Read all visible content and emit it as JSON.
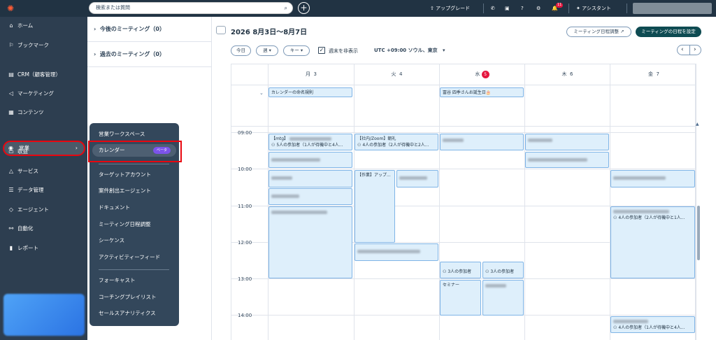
{
  "topbar": {
    "search_placeholder": "検索または質問",
    "upgrade_label": "アップグレード",
    "notification_count": "11",
    "assistant_label": "アシスタント"
  },
  "sidebar": {
    "items": [
      {
        "label": "ホーム",
        "icon": "home-icon"
      },
      {
        "label": "ブックマーク",
        "icon": "bookmark-icon"
      },
      {
        "label": "CRM（顧客管理）",
        "icon": "crm-icon"
      },
      {
        "label": "マーケティング",
        "icon": "marketing-icon"
      },
      {
        "label": "コンテンツ",
        "icon": "content-icon"
      },
      {
        "label": "営業",
        "icon": "sales-icon"
      },
      {
        "label": "収益",
        "icon": "revenue-icon"
      },
      {
        "label": "サービス",
        "icon": "service-icon"
      },
      {
        "label": "データ管理",
        "icon": "database-icon"
      },
      {
        "label": "エージェント",
        "icon": "agent-icon"
      },
      {
        "label": "自動化",
        "icon": "automation-icon"
      },
      {
        "label": "レポート",
        "icon": "report-icon"
      }
    ]
  },
  "flyout": {
    "items": [
      "営業ワークスペース",
      "カレンダー",
      "ターゲットアカウント",
      "案件創出エージェント",
      "ドキュメント",
      "ミーティング日程調整",
      "シーケンス",
      "アクティビティーフィード",
      "フォーキャスト",
      "コーチングプレイリスト",
      "セールスアナリティクス"
    ],
    "beta_label": "ベータ"
  },
  "meetings": {
    "upcoming": "今後のミーティング（0）",
    "past": "過去のミーティング（0）"
  },
  "calendar": {
    "title": "2026 8月3日〜8月7日",
    "scheduling_button": "ミーティング日程調整",
    "set_meeting_button": "ミーティングの日程を設定",
    "today_button": "今日",
    "view_select": "週",
    "key_select": "キー",
    "hide_weekend_label": "週末を非表示",
    "timezone": "UTC +09:00 ソウル、東京",
    "days": [
      {
        "name": "月",
        "num": "3"
      },
      {
        "name": "火",
        "num": "4"
      },
      {
        "name": "水",
        "num": "5"
      },
      {
        "name": "木",
        "num": "6"
      },
      {
        "name": "金",
        "num": "7"
      }
    ],
    "hours": [
      "09:00",
      "10:00",
      "11:00",
      "12:00",
      "13:00",
      "14:00"
    ],
    "allday": {
      "mon": "カレンダーの命名規則",
      "wed": "冨谷 四季さんお誕生日🎂"
    },
    "events": {
      "mon_mtg_title": "【mtg】",
      "mon_mtg_sub": "5人の参加者（1人が待機中と4人...",
      "tue_zoom_title": "【社内/Zoom】朝礼",
      "tue_zoom_sub": "4人の参加者（2人が待機中と2人...",
      "tue_work": "【作業】アップ...",
      "fri_1100_sub": "4人の参加者（2人が待機中と1人...",
      "wed_1300_a": "3人の参加者",
      "wed_1300_b": "3人の参加者",
      "wed_seminar": "セミナー",
      "fri_1400_sub": "4人の参加者（1人が待機中と4人..."
    }
  }
}
